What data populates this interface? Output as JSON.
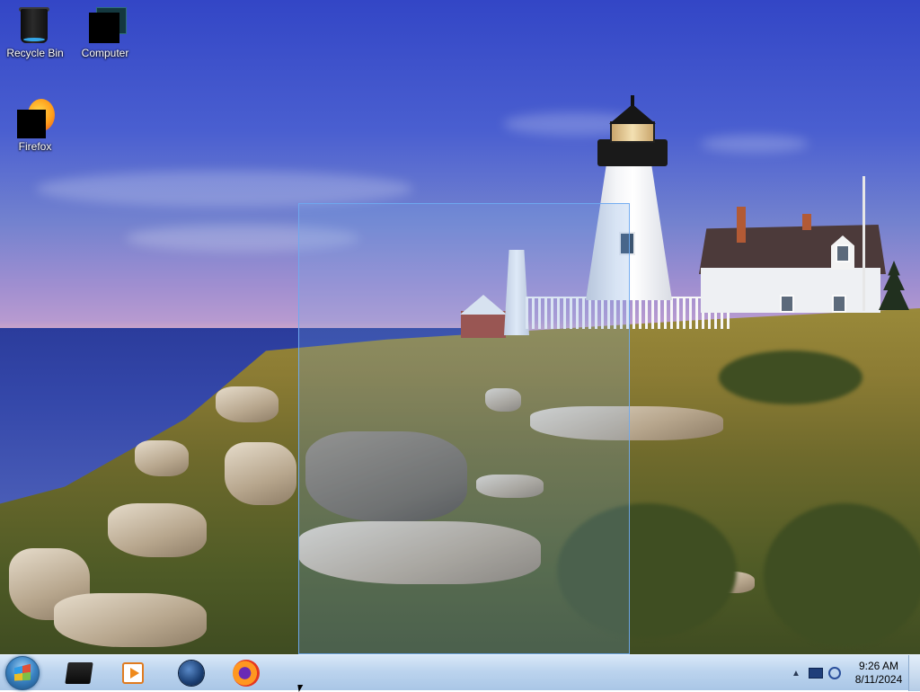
{
  "desktop": {
    "icons": [
      {
        "label": "Recycle Bin",
        "icon": "recycle-bin-icon"
      },
      {
        "label": "Computer",
        "icon": "computer-icon"
      },
      {
        "label": "Firefox",
        "icon": "firefox-icon"
      }
    ]
  },
  "taskbar": {
    "start_icon": "windows-start-orb",
    "pinned": [
      {
        "icon": "file-explorer-icon"
      },
      {
        "icon": "media-player-icon"
      },
      {
        "icon": "internet-globe-icon"
      },
      {
        "icon": "firefox-icon"
      }
    ],
    "tray": {
      "show_hidden_icon": "▲",
      "time": "9:26 AM",
      "date": "8/11/2024"
    }
  },
  "colors": {
    "taskbar_top": "#d9e8f8",
    "taskbar_bottom": "#a9c6e6",
    "selection_border": "#6eaaf0"
  }
}
